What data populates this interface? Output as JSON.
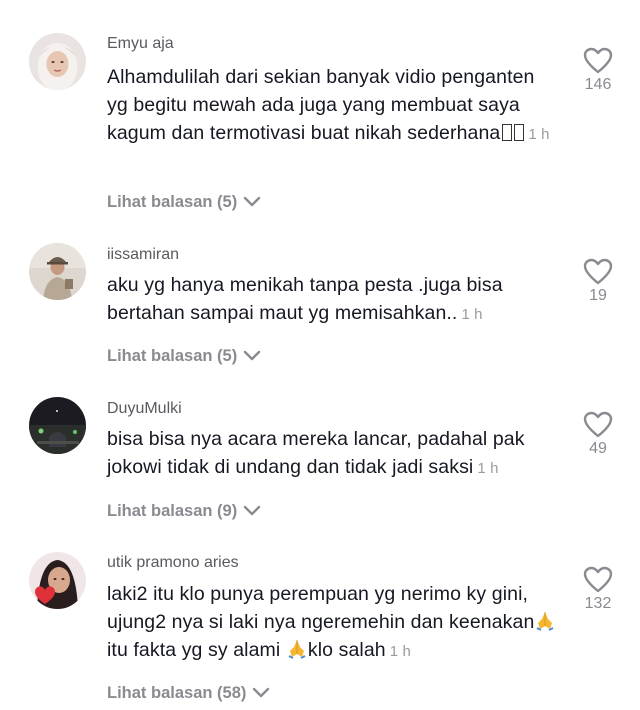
{
  "comments": [
    {
      "username": "Emyu aja",
      "avatar_icon": "avatar-woman-hijab-icon",
      "text": "Alhamdulilah dari sekian banyak vidio penganten yg begitu mewah ada juga yang membuat saya kagum dan termotivasi buat nikah sederhana",
      "time": "1 h",
      "replies": "Lihat balasan (5)",
      "likes": "146"
    },
    {
      "username": "iissamiran",
      "avatar_icon": "avatar-man-cap-icon",
      "text": "aku yg hanya menikah tanpa pesta .juga bisa bertahan sampai maut yg memisahkan..",
      "time": "1 h",
      "replies": "Lihat balasan (5)",
      "likes": "19"
    },
    {
      "username": "DuyuMulki",
      "avatar_icon": "avatar-night-scene-icon",
      "text": "bisa bisa nya acara mereka lancar, padahal pak jokowi tidak di undang dan tidak jadi saksi",
      "time": "1 h",
      "replies": "Lihat balasan (9)",
      "likes": "49"
    },
    {
      "username": "utik pramono aries",
      "avatar_icon": "avatar-woman-heart-icon",
      "text_parts": [
        "laki2 itu klo punya perempuan yg nerimo ky gini, ujung2 nya si laki nya ngeremehin dan keenakan",
        " itu fakta yg sy alami ",
        "klo salah"
      ],
      "time": "1 h",
      "replies": "Lihat balasan (58)",
      "likes": "132"
    }
  ],
  "colors": {
    "text": "#161823",
    "secondary": "#8a8b91",
    "username": "#5a5a60"
  },
  "icons": {
    "like": "heart-outline-icon",
    "expand": "chevron-down-icon",
    "emoji": "folded-hands-emoji-icon"
  }
}
